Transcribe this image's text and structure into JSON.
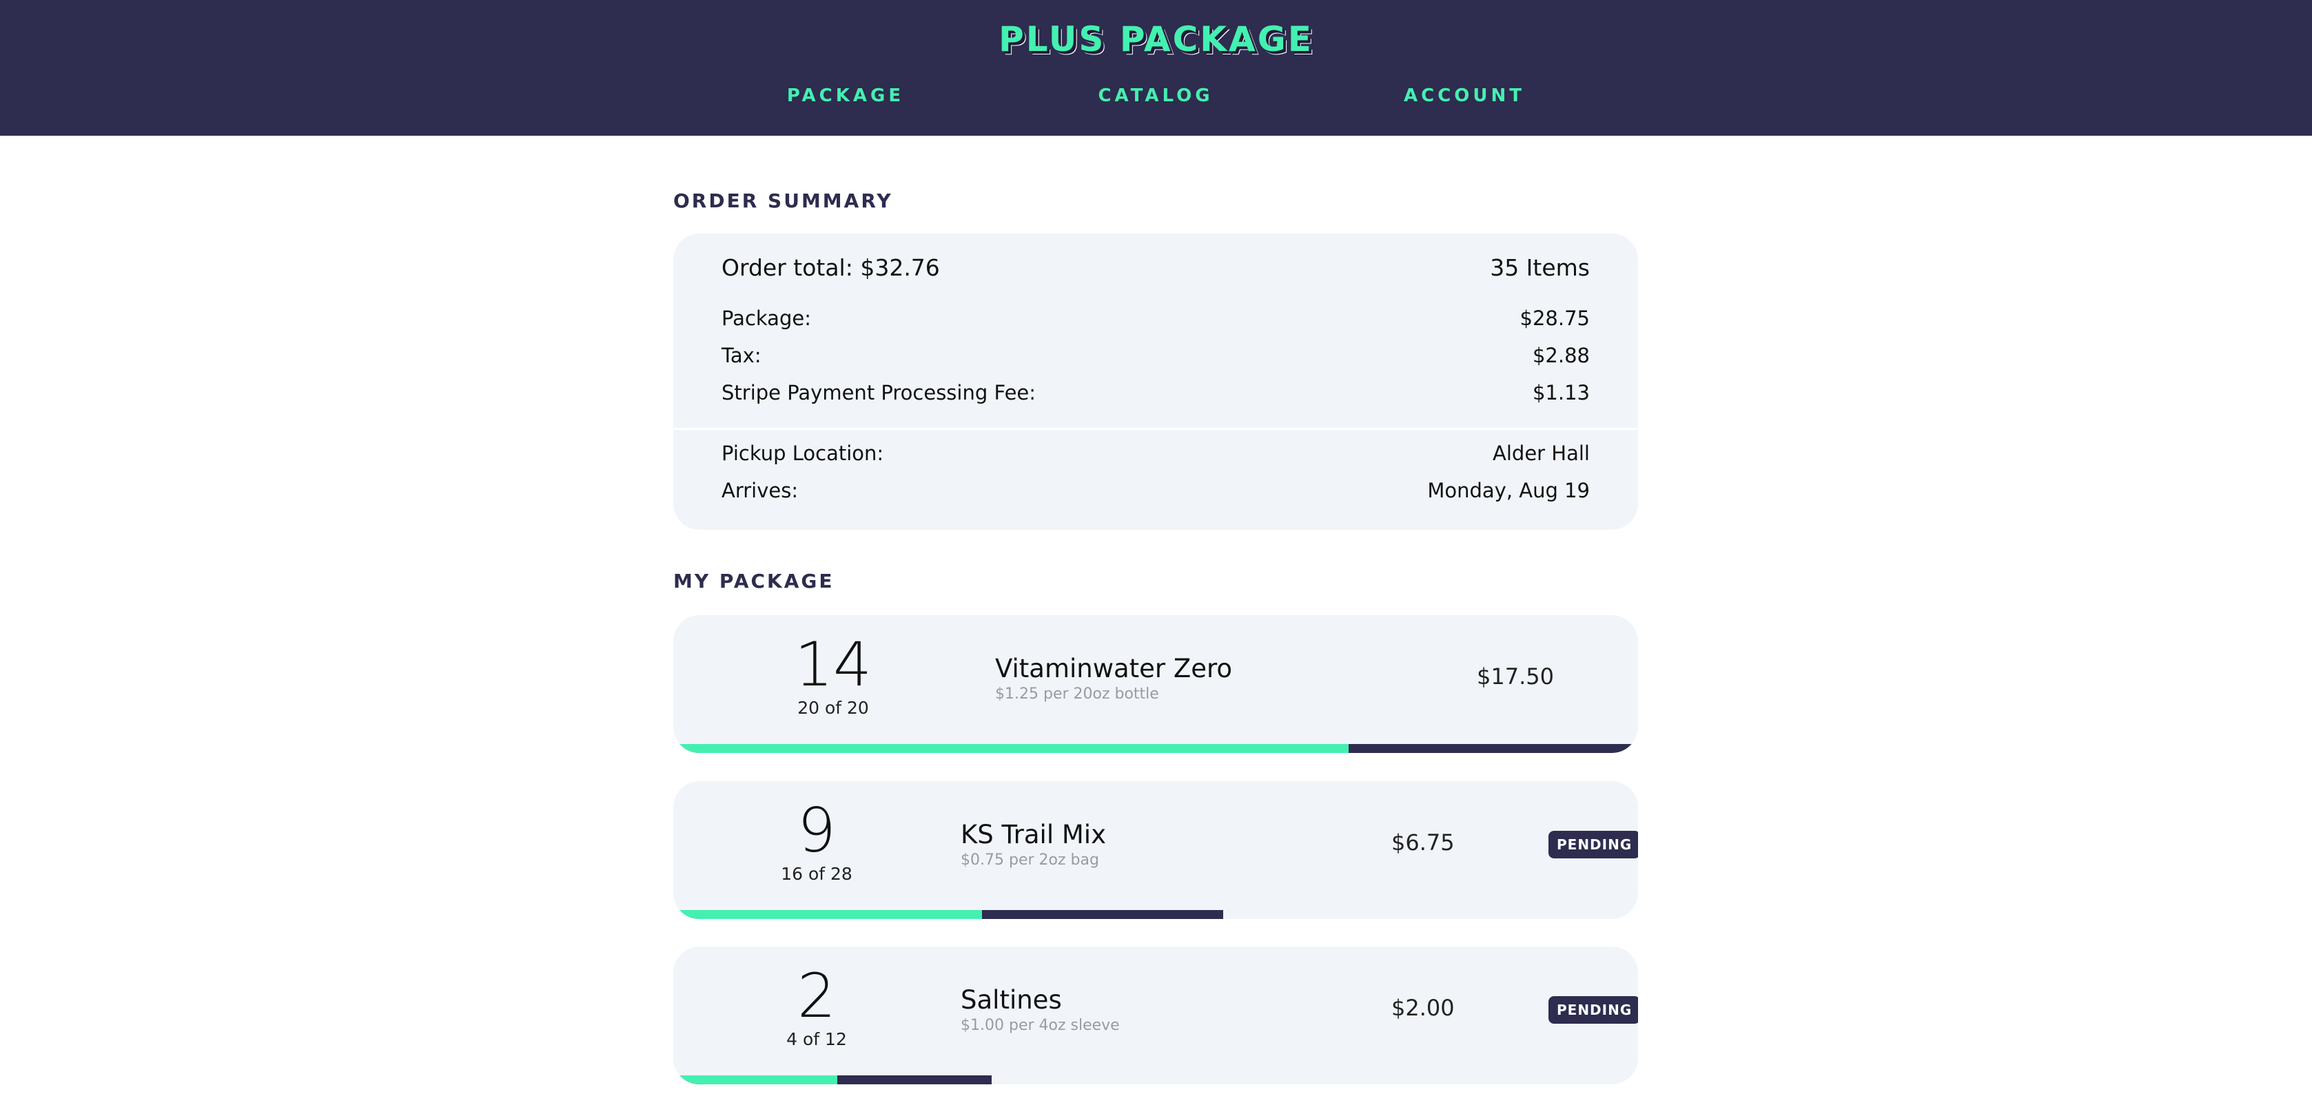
{
  "header": {
    "title": "PLUS PACKAGE",
    "nav": [
      {
        "label": "PACKAGE"
      },
      {
        "label": "CATALOG"
      },
      {
        "label": "ACCOUNT"
      }
    ]
  },
  "summary": {
    "section_title": "ORDER SUMMARY",
    "total_label": "Order total: $32.76",
    "items_count": "35 Items",
    "rows": [
      {
        "label": "Package:",
        "value": "$28.75"
      },
      {
        "label": "Tax:",
        "value": "$2.88"
      },
      {
        "label": "Stripe Payment Processing Fee:",
        "value": "$1.13"
      }
    ],
    "pickup": {
      "label": "Pickup Location:",
      "value": "Alder Hall"
    },
    "arrives": {
      "label": "Arrives:",
      "value": "Monday, Aug 19"
    }
  },
  "package": {
    "section_title": "MY PACKAGE",
    "items": [
      {
        "qty": "14",
        "of": "20 of 20",
        "name": "Vitaminwater Zero",
        "unit": "$1.25 per 20oz bottle",
        "price": "$17.50",
        "badge": "",
        "fill_fraction": 0.7,
        "track_fraction": 1.0
      },
      {
        "qty": "9",
        "of": "16 of 28",
        "name": "KS Trail Mix",
        "unit": "$0.75 per 2oz bag",
        "price": "$6.75",
        "badge": "PENDING",
        "fill_fraction": 0.32,
        "track_fraction": 0.57
      },
      {
        "qty": "2",
        "of": "4 of 12",
        "name": "Saltines",
        "unit": "$1.00 per 4oz sleeve",
        "price": "$2.00",
        "badge": "PENDING",
        "fill_fraction": 0.17,
        "track_fraction": 0.33
      }
    ]
  },
  "colors": {
    "header_bg": "#2e2c4f",
    "accent": "#44f0b0",
    "card_bg": "#f1f5f9",
    "badge_bg": "#2e2c4f"
  }
}
